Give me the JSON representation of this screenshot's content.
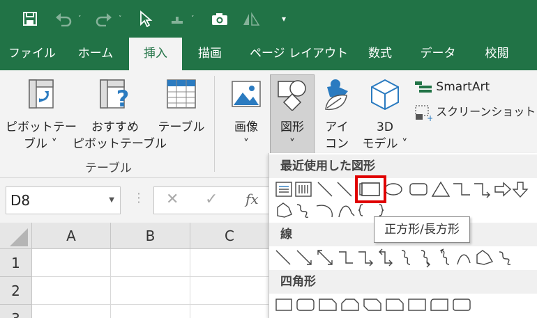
{
  "quick_access": {
    "icons": [
      "save-icon",
      "undo-icon",
      "redo-icon",
      "select-objects-icon",
      "touch-mode-icon",
      "camera-icon",
      "align-icon",
      "customize-icon"
    ]
  },
  "tabs": [
    {
      "label": "ファイル",
      "active": false
    },
    {
      "label": "ホーム",
      "active": false
    },
    {
      "label": "挿入",
      "active": true
    },
    {
      "label": "描画",
      "active": false
    },
    {
      "label": "ページ レイアウト",
      "active": false
    },
    {
      "label": "数式",
      "active": false
    },
    {
      "label": "データ",
      "active": false
    },
    {
      "label": "校閲",
      "active": false
    }
  ],
  "ribbon": {
    "pivot_table": {
      "line1": "ピボットテー",
      "line2": "ブル ˅"
    },
    "recommended_pivot": {
      "line1": "おすすめ",
      "line2": "ピボットテーブル"
    },
    "table": {
      "line1": "テーブル"
    },
    "group_tables": "テーブル",
    "image": {
      "line1": "画像",
      "line2": "˅"
    },
    "shapes": {
      "line1": "図形",
      "line2": "˅"
    },
    "icons_btn": {
      "line1": "アイ",
      "line2": "コン"
    },
    "models3d": {
      "line1": "3D",
      "line2": "モデル ˅"
    },
    "smartart": "SmartArt",
    "screenshot": "スクリーンショット ˅"
  },
  "formula_bar": {
    "name_box": "D8",
    "fx": "fx"
  },
  "grid": {
    "columns": [
      "A",
      "B",
      "C"
    ],
    "rows": [
      "1",
      "2",
      "3"
    ]
  },
  "shapes_gallery": {
    "recent_header": "最近使用した図形",
    "lines_header": "線",
    "rect_header": "四角形",
    "tooltip": "正方形/長方形"
  },
  "colors": {
    "excel_green": "#217346",
    "highlight_red": "#e00000"
  }
}
